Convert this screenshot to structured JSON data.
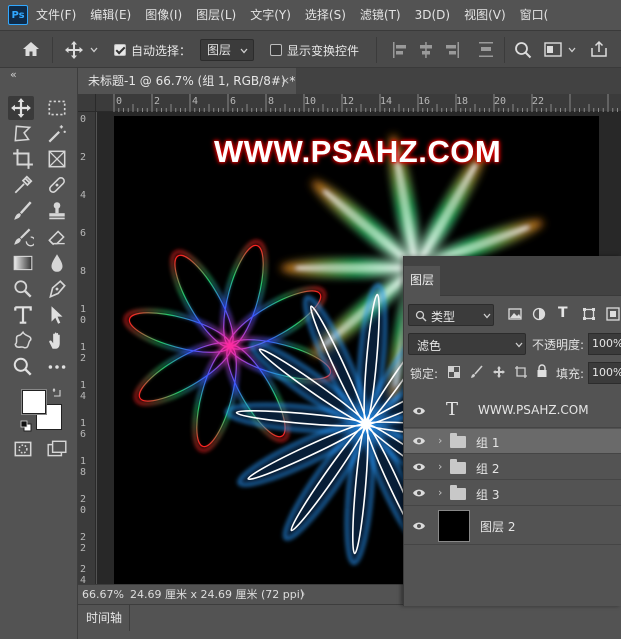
{
  "app": {
    "logo": "Ps"
  },
  "menu": [
    "文件(F)",
    "编辑(E)",
    "图像(I)",
    "图层(L)",
    "文字(Y)",
    "选择(S)",
    "滤镜(T)",
    "3D(D)",
    "视图(V)",
    "窗口("
  ],
  "options": {
    "auto_select_label": "自动选择：",
    "auto_select_checked": true,
    "auto_select_value": "图层",
    "show_transform_label": "显示变换控件",
    "show_transform_checked": false
  },
  "document": {
    "tab_title": "未标题-1 @ 66.7% (组 1, RGB/8#) *",
    "close_glyph": "×",
    "collapse_glyph": "«",
    "watermark": "WWW.PSAHZ.COM"
  },
  "rulers": {
    "horizontal": [
      "0",
      "2",
      "4",
      "6",
      "8",
      "10",
      "12",
      "14",
      "16",
      "18",
      "20",
      "22"
    ],
    "vertical": [
      "0",
      "2",
      "4",
      "6",
      "8",
      "1\n0",
      "1\n2",
      "1\n4",
      "1\n6",
      "1\n8",
      "2\n0",
      "2\n2",
      "2\n4"
    ]
  },
  "status": {
    "zoom": "66.67%",
    "doc_size": "24.69 厘米 x 24.69 厘米 (72 ppi)",
    "arrow": "〉"
  },
  "timeline": {
    "tab_label": "时间轴"
  },
  "layers_panel": {
    "tab_label": "图层",
    "filter_label": "类型",
    "blend_mode": "滤色",
    "opacity_label": "不透明度:",
    "opacity_value": "100%",
    "lock_label": "锁定:",
    "fill_label": "填充:",
    "fill_value": "100%",
    "text_glyph": "T",
    "layers": [
      {
        "name": "WWW.PSAHZ.COM",
        "type": "text",
        "selected": false
      },
      {
        "name": "组 1",
        "type": "group",
        "selected": true
      },
      {
        "name": "组 2",
        "type": "group",
        "selected": false
      },
      {
        "name": "组 3",
        "type": "group",
        "selected": false
      },
      {
        "name": "图层 2",
        "type": "pixel",
        "selected": false
      }
    ]
  },
  "colors": {
    "foreground": "#ffffff",
    "background": "#ffffff",
    "accent": "#31a8ff"
  }
}
